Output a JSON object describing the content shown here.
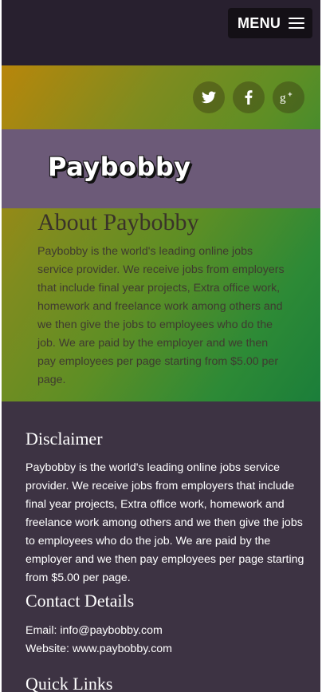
{
  "header": {
    "menu_label": "MENU",
    "menu_icon": "hamburger-icon"
  },
  "social": [
    {
      "name": "twitter",
      "glyph": "t"
    },
    {
      "name": "facebook",
      "glyph": "f"
    },
    {
      "name": "google-plus",
      "glyph": "g+"
    }
  ],
  "brand": {
    "name": "Paybobby"
  },
  "about": {
    "title": "About Paybobby",
    "text": "Paybobby is the world's leading online jobs service provider. We receive jobs from employers that include final year projects, Extra office work, homework and freelance work among others and we then give the jobs to employees who do the job. We are paid by the employer and we then pay employees per page starting from $5.00 per page."
  },
  "disclaimer": {
    "title": "Disclaimer",
    "text": "Paybobby is the world's leading online jobs service provider. We receive jobs from employers that include final year projects, Extra office work, homework and freelance work among others and we then give the jobs to employees who do the job. We are paid by the employer and we then pay employees per page starting from $5.00 per page."
  },
  "contact": {
    "title": "Contact Details",
    "email": "Email: info@paybobby.com",
    "website": "Website: www.paybobby.com"
  },
  "quick_links": {
    "title": "Quick Links"
  },
  "colors": {
    "topbar": "#28202f",
    "menu_button": "#141016",
    "brand_band": "#6c5a78",
    "footer": "#3d3343",
    "gradient_start": "#b8860b",
    "gradient_end": "#1b7e3a"
  }
}
